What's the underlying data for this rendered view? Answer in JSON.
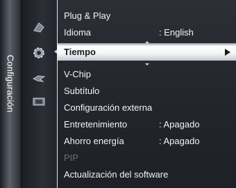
{
  "sidebar": {
    "section_label": "Configuración"
  },
  "icons": [
    "picture-icon",
    "settings-gear-icon",
    "support-icon",
    "input-icon"
  ],
  "menu": {
    "items": [
      {
        "label": "Plug & Play",
        "value": ""
      },
      {
        "label": "Idioma",
        "value": ": English"
      },
      {
        "label": "Tiempo",
        "value": ""
      },
      {
        "label": "V-Chip",
        "value": ""
      },
      {
        "label": "Subtítulo",
        "value": ""
      },
      {
        "label": "Configuración externa",
        "value": ""
      },
      {
        "label": "Entretenimiento",
        "value": ": Apagado"
      },
      {
        "label": "Ahorro energía",
        "value": ": Apagado"
      },
      {
        "label": "PIP",
        "value": ""
      },
      {
        "label": "Actualización del software",
        "value": ""
      }
    ]
  },
  "colors": {
    "highlight": "#ffffff",
    "text": "#f2f3f5",
    "disabled": "#6b7078"
  }
}
